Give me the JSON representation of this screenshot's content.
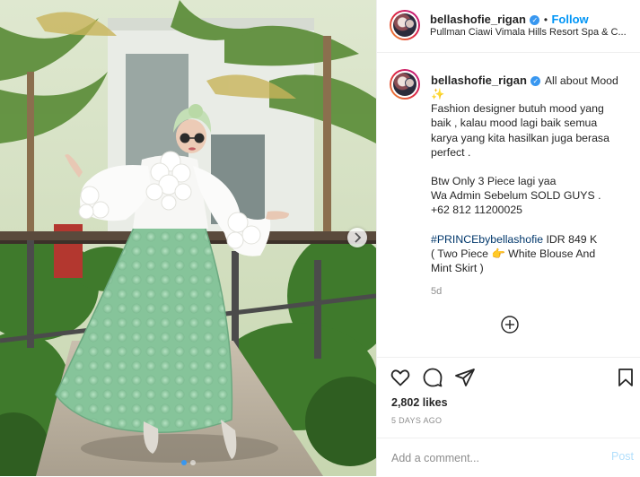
{
  "header": {
    "username": "bellashofie_rigan",
    "verified_symbol": "✓",
    "separator": "•",
    "follow_label": "Follow",
    "location": "Pullman Ciawi Vimala Hills Resort Spa & C..."
  },
  "caption": {
    "username": "bellashofie_rigan",
    "verified_symbol": "✓",
    "title": "All about Mood",
    "sparkle_emoji": "✨",
    "lines": [
      "Fashion designer butuh mood yang",
      "baik , kalau mood lagi baik semua",
      "karya yang kita hasilkan juga berasa",
      "perfect ."
    ],
    "lines2": [
      "Btw Only 3 Piece lagi yaa",
      "Wa Admin Sebelum SOLD GUYS .",
      "+62 812 11200025"
    ],
    "hashtag": "#PRINCEbybellashofie",
    "price": " IDR 849 K",
    "detail_line1_pre": "( Two Piece ",
    "detail_line1_emoji": "👉",
    "detail_line1_post": " White Blouse And",
    "detail_line2": "Mint Skirt )",
    "time_ago": "5d"
  },
  "actions": {
    "icons": [
      "heart-icon",
      "comment-icon",
      "share-icon",
      "bookmark-icon"
    ],
    "likes": "2,802 likes",
    "date": "5 DAYS AGO"
  },
  "comment": {
    "placeholder": "Add a comment...",
    "post_label": "Post"
  },
  "carousel": {
    "total": 2,
    "active_index": 0
  },
  "colors": {
    "accent": "#0095f6",
    "verified": "#3897f0",
    "skirt_mint": "#8cc9a0",
    "blouse_white": "#ffffff"
  }
}
